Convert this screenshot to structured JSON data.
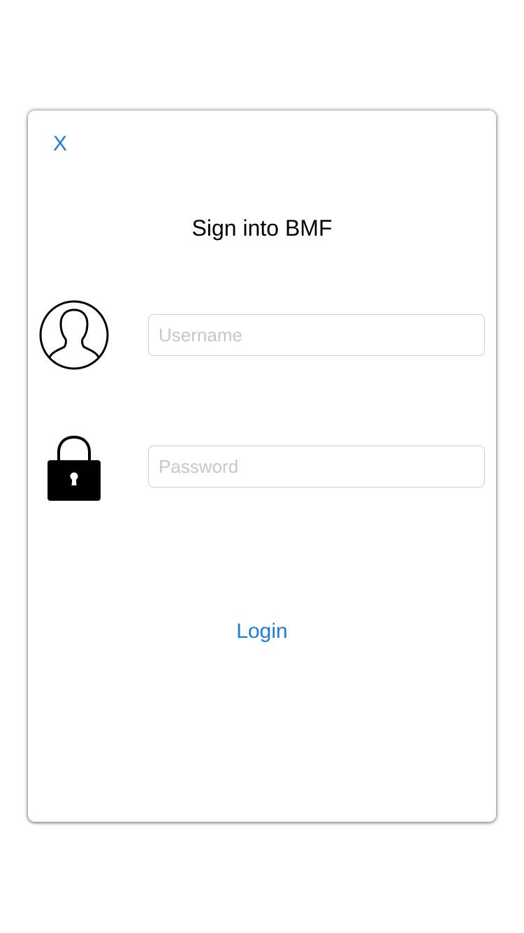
{
  "dialog": {
    "close_label": "X",
    "title": "Sign into BMF",
    "username": {
      "placeholder": "Username",
      "value": "",
      "icon": "user-avatar-icon"
    },
    "password": {
      "placeholder": "Password",
      "value": "",
      "icon": "lock-icon"
    },
    "login_label": "Login"
  },
  "colors": {
    "accent": "#1a7de0",
    "placeholder": "#c7c7cd",
    "field_border": "#cfcfcf"
  }
}
